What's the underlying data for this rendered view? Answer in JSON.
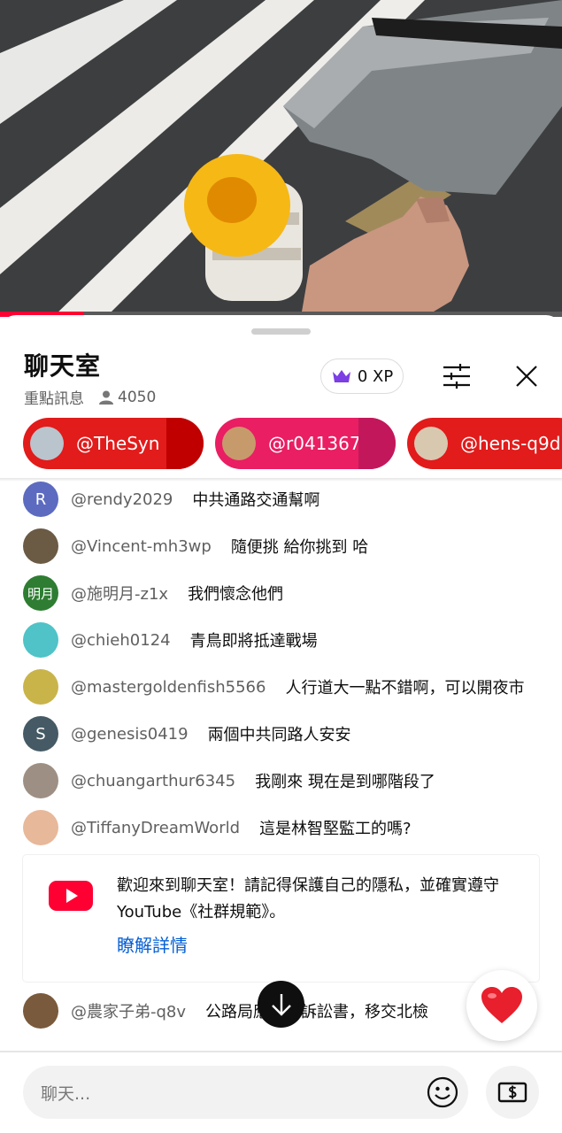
{
  "video": {
    "progress_fraction": 0.15
  },
  "chat": {
    "title": "聊天室",
    "mode": "重點訊息",
    "viewer_count": "4050",
    "xp": "0 XP",
    "pinned": [
      {
        "name": "@TheSyn",
        "color": "#e21b1b",
        "edge": "#c00000"
      },
      {
        "name": "@r041367",
        "color": "#e91e63",
        "edge": "#c2185b"
      },
      {
        "name": "@hens-q9d",
        "color": "#e21b1b",
        "edge": "#c00000"
      }
    ],
    "messages": [
      {
        "author": "@rendy2029",
        "text": "中共通路交通幫啊",
        "avatar": "R",
        "avatar_color": "#5c6bc0"
      },
      {
        "author": "@Vincent-mh3wp",
        "text": "隨便挑 給你挑到 哈",
        "avatar": "",
        "avatar_color": "#6b5a44"
      },
      {
        "author": "@施明月-z1x",
        "text": "我們懷念他們",
        "avatar": "明月",
        "avatar_color": "#2e7d32"
      },
      {
        "author": "@chieh0124",
        "text": "青鳥即將抵達戰場",
        "avatar": "",
        "avatar_color": "#4fc3c7"
      },
      {
        "author": "@mastergoldenfish5566",
        "text": "人行道大一點不錯啊，可以開夜市",
        "avatar": "",
        "avatar_color": "#c9b44a"
      },
      {
        "author": "@genesis0419",
        "text": "兩個中共同路人安安",
        "avatar": "S",
        "avatar_color": "#455a64"
      },
      {
        "author": "@chuangarthur6345",
        "text": "我剛來 現在是到哪階段了",
        "avatar": "",
        "avatar_color": "#9e8f84"
      },
      {
        "author": "@TiffanyDreamWorld",
        "text": "這是林智堅監工的嗎?",
        "avatar": "",
        "avatar_color": "#e8b89a"
      }
    ],
    "welcome": {
      "text": "歡迎來到聊天室！請記得保護自己的隱私，並確實遵守 YouTube《社群規範》。",
      "learn_more": "瞭解詳情"
    },
    "last_message": {
      "author": "@農家子弟-q8v",
      "text": "公路局應該寫訴訟書，移交北檢",
      "avatar_color": "#7a5a3c"
    },
    "input_placeholder": "聊天...",
    "accent": "#ff0033",
    "link_color": "#065fd4"
  }
}
